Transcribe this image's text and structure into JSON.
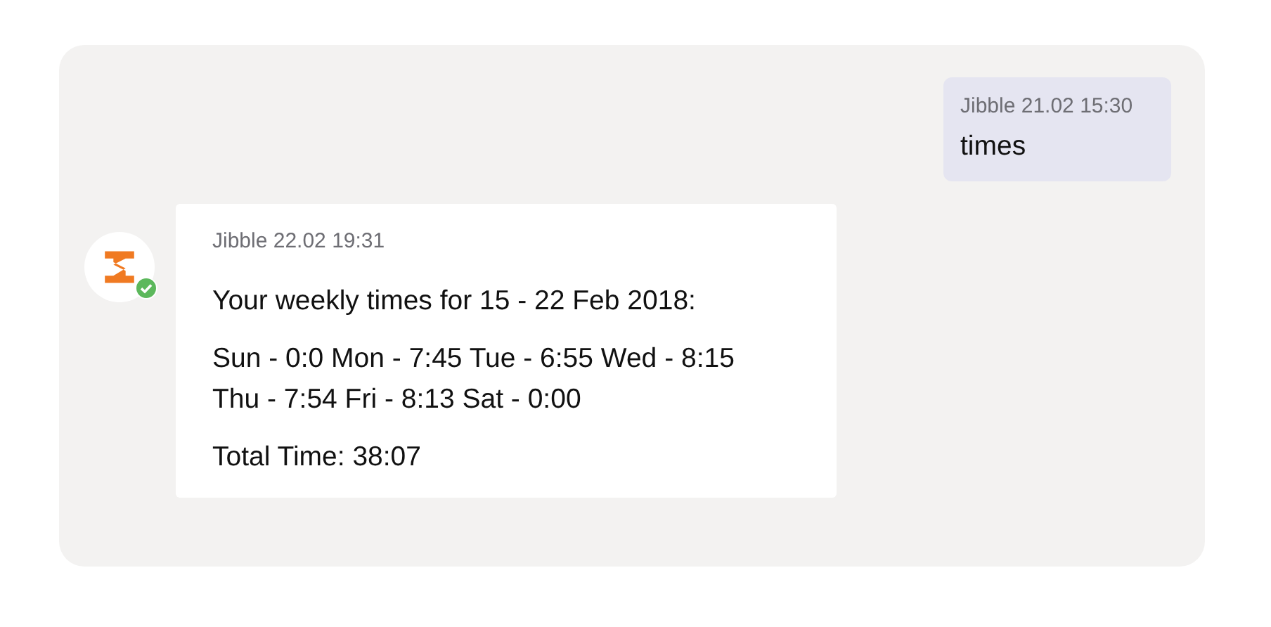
{
  "messages": [
    {
      "kind": "outgoing",
      "sender": "Jibble",
      "time": "21.02 15:30",
      "paragraphs": [
        [
          "times"
        ]
      ]
    },
    {
      "kind": "incoming",
      "sender": "Jibble",
      "time": "22.02 19:31",
      "avatar_verified": true,
      "paragraphs": [
        [
          "Your weekly times for 15 - 22 Feb 2018:"
        ],
        [
          "Sun - 0:0 Mon - 7:45 Tue - 6:55 Wed - 8:15",
          "Thu - 7:54 Fri - 8:13 Sat - 0:00"
        ],
        [
          "Total Time: 38:07"
        ]
      ]
    }
  ]
}
